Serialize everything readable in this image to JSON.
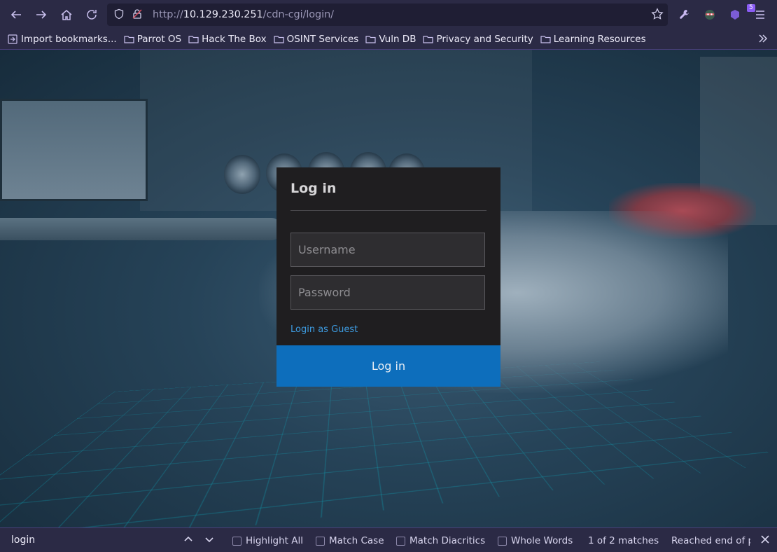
{
  "browser": {
    "url_prefix": "http://",
    "url_host": "10.129.230.251",
    "url_path": "/cdn-cgi/login/",
    "extension_badge": "5"
  },
  "bookmarks": [
    {
      "label": "Import bookmarks...",
      "icon": "import-icon"
    },
    {
      "label": "Parrot OS",
      "icon": "folder-icon"
    },
    {
      "label": "Hack The Box",
      "icon": "folder-icon"
    },
    {
      "label": "OSINT Services",
      "icon": "folder-icon"
    },
    {
      "label": "Vuln DB",
      "icon": "folder-icon"
    },
    {
      "label": "Privacy and Security",
      "icon": "folder-icon"
    },
    {
      "label": "Learning Resources",
      "icon": "folder-icon"
    }
  ],
  "login": {
    "title": "Log in",
    "username_placeholder": "Username",
    "password_placeholder": "Password",
    "guest_link": "Login as Guest",
    "submit_label": "Log in"
  },
  "findbar": {
    "query": "login",
    "highlight_all": "Highlight All",
    "match_case": "Match Case",
    "match_diacritics": "Match Diacritics",
    "whole_words": "Whole Words",
    "match_count": "1 of 2 matches",
    "status": "Reached end of p"
  },
  "colors": {
    "toolbar": "#2b2a45",
    "accent_button": "#0d6ebc",
    "guest_link": "#3d9be0"
  }
}
